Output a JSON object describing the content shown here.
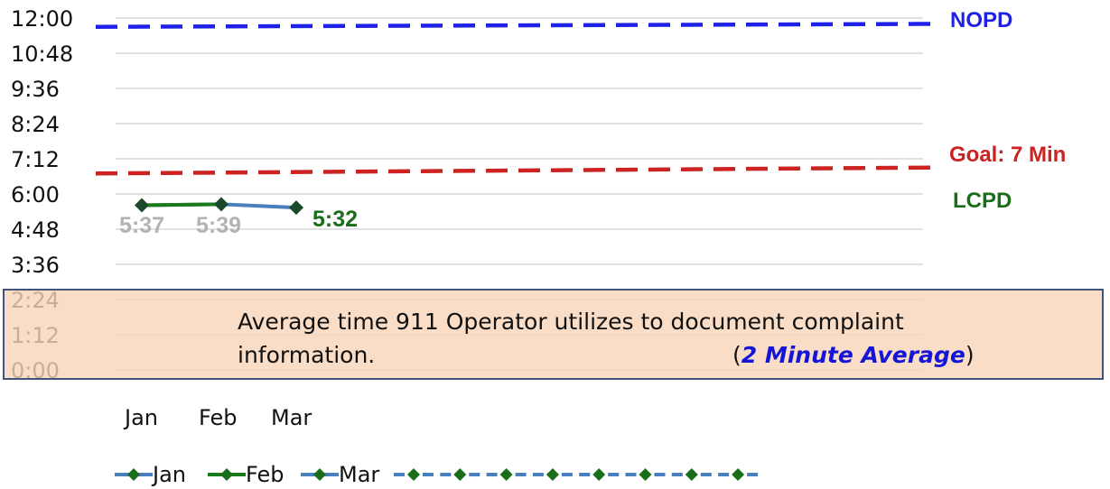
{
  "chart_data": {
    "type": "line",
    "categories": [
      "Jan",
      "Feb",
      "Mar"
    ],
    "y_ticks": [
      "12:00",
      "10:48",
      "9:36",
      "8:24",
      "7:12",
      "6:00",
      "4:48",
      "3:36",
      "2:24",
      "1:12",
      "0:00"
    ],
    "y_unit": "minutes",
    "ylim": [
      0,
      12
    ],
    "grid": true,
    "series": [
      {
        "name": "Jan",
        "color": "#4a7fbd",
        "points": [
          {
            "x": "Jan",
            "y": 5.617
          },
          {
            "x": "Feb",
            "y": 5.65
          }
        ]
      },
      {
        "name": "Feb",
        "color": "#1a7a1a",
        "points": [
          {
            "x": "Jan",
            "y": 5.617
          },
          {
            "x": "Feb",
            "y": 5.65
          }
        ]
      },
      {
        "name": "Mar",
        "color": "#4a7fbd",
        "points": [
          {
            "x": "Feb",
            "y": 5.65
          },
          {
            "x": "Mar",
            "y": 5.533
          }
        ]
      }
    ],
    "data_labels": [
      {
        "category": "Jan",
        "text": "5:37",
        "color": "#b3b3b3"
      },
      {
        "category": "Feb",
        "text": "5:39",
        "color": "#b3b3b3"
      },
      {
        "category": "Mar",
        "text": "5:32",
        "color": "#1a6e1a"
      }
    ],
    "series_label": {
      "text": "LCPD",
      "color": "#1a6e1a"
    },
    "reference_lines": [
      {
        "label": "NOPD",
        "y_start": 11.7,
        "y_end": 11.8,
        "color": "#1f22e6",
        "style": "dashed"
      },
      {
        "label": "Goal: 7 Min",
        "y_start": 6.7,
        "y_end": 6.9,
        "color": "#cc2222",
        "style": "dashed"
      }
    ],
    "legend": {
      "placement": "bottom",
      "entries": [
        {
          "label": "Jan",
          "color": "#4a7fbd",
          "line_color": "#4a7fbd"
        },
        {
          "label": "Feb",
          "color": "#1a7a1a",
          "line_color": "#1a7a1a"
        },
        {
          "label": "Mar",
          "color": "#4a7fbd",
          "line_color": "#4a7fbd"
        }
      ],
      "unlabeled_markers": 8,
      "marker_color": "#1a4a2a"
    },
    "annotation": {
      "line1": "Average time 911 Operator utilizes to document complaint",
      "line2": "information.",
      "paren_open": "(",
      "emphasis": "2 Minute Average",
      "paren_close": ")",
      "fill": "#f8d4b8",
      "border": "#41557a"
    }
  }
}
